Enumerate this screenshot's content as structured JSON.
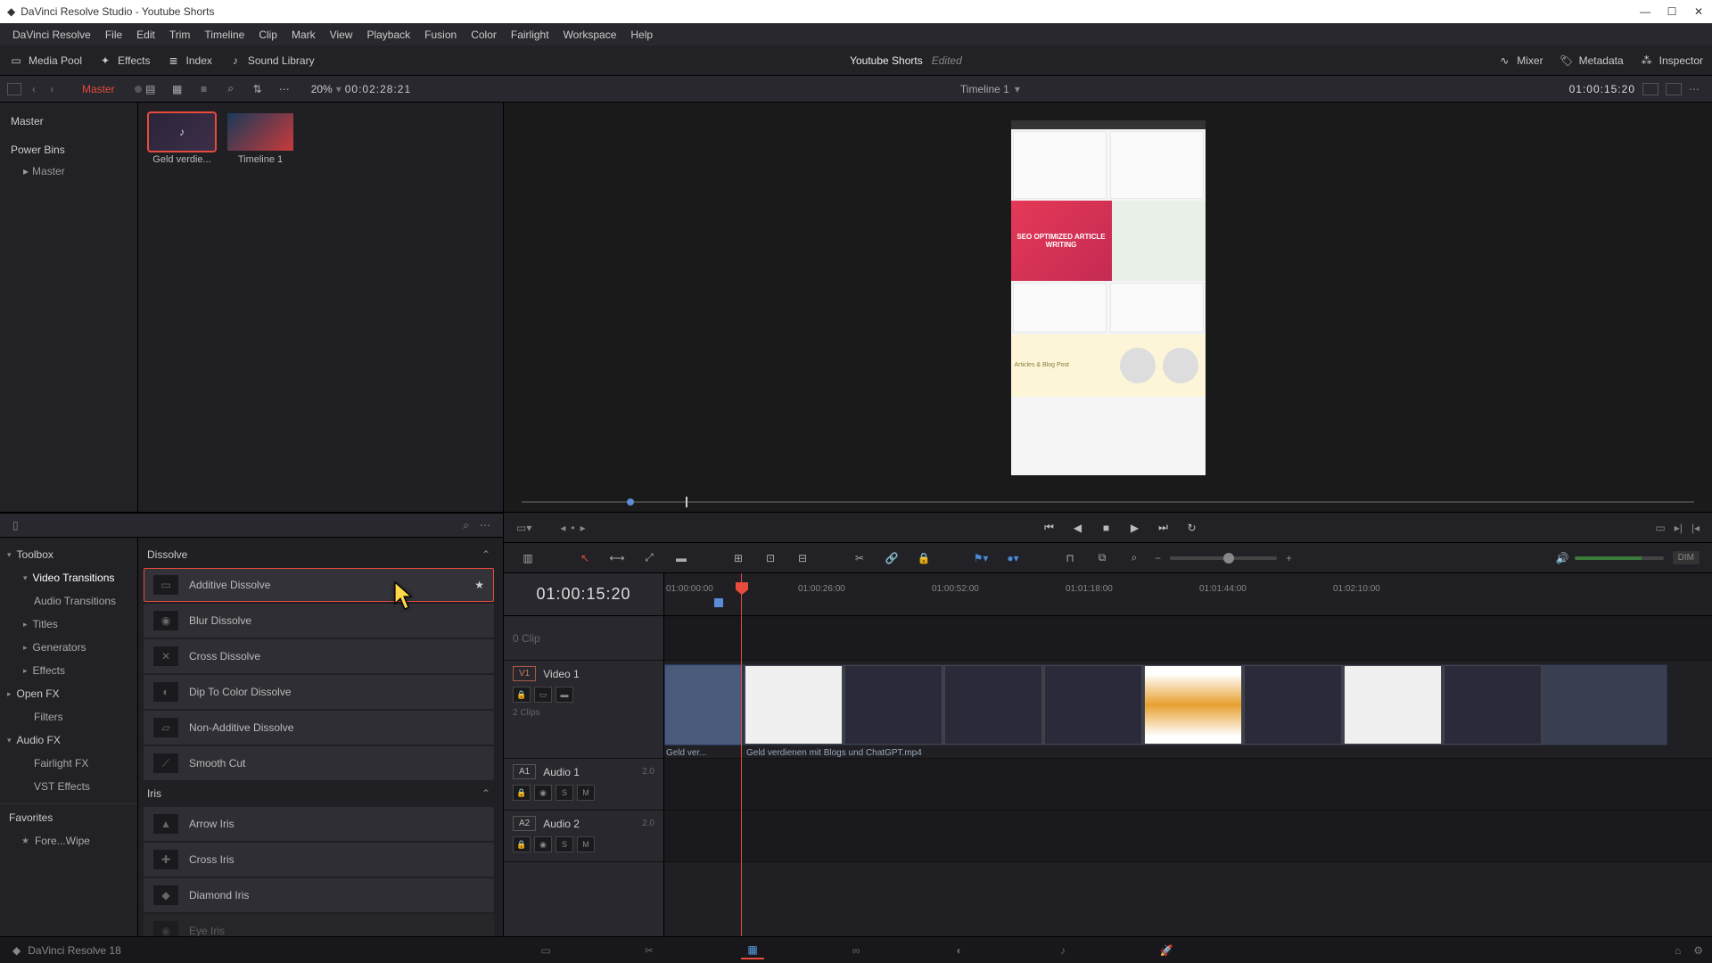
{
  "window": {
    "title": "DaVinci Resolve Studio - Youtube Shorts"
  },
  "menu": [
    "DaVinci Resolve",
    "File",
    "Edit",
    "Trim",
    "Timeline",
    "Clip",
    "Mark",
    "View",
    "Playback",
    "Fusion",
    "Color",
    "Fairlight",
    "Workspace",
    "Help"
  ],
  "toolbar": {
    "mediaPool": "Media Pool",
    "effects": "Effects",
    "index": "Index",
    "soundLib": "Sound Library",
    "project": "Youtube Shorts",
    "status": "Edited",
    "mixer": "Mixer",
    "metadata": "Metadata",
    "inspector": "Inspector"
  },
  "subbar": {
    "master": "Master",
    "zoom": "20%",
    "sourceTC": "00:02:28:21",
    "timelineName": "Timeline 1",
    "recordTC": "01:00:15:20"
  },
  "mediaPool": {
    "tree": {
      "master": "Master",
      "powerBins": "Power Bins",
      "pbMaster": "Master"
    },
    "clips": [
      {
        "label": "Geld verdie...",
        "kind": "audio",
        "selected": true
      },
      {
        "label": "Timeline 1",
        "kind": "timeline",
        "selected": false
      }
    ]
  },
  "fx": {
    "categories": {
      "toolbox": "Toolbox",
      "videoTransitions": "Video Transitions",
      "audioTransitions": "Audio Transitions",
      "titles": "Titles",
      "generators": "Generators",
      "effects": "Effects",
      "openfx": "Open FX",
      "filters": "Filters",
      "audiofx": "Audio FX",
      "fairlightfx": "Fairlight FX",
      "vstfx": "VST Effects",
      "favorites": "Favorites",
      "favItem": "Fore...Wipe"
    },
    "groups": [
      {
        "name": "Dissolve",
        "items": [
          {
            "name": "Additive Dissolve",
            "selected": true
          },
          {
            "name": "Blur Dissolve"
          },
          {
            "name": "Cross Dissolve"
          },
          {
            "name": "Dip To Color Dissolve"
          },
          {
            "name": "Non-Additive Dissolve"
          },
          {
            "name": "Smooth Cut"
          }
        ]
      },
      {
        "name": "Iris",
        "items": [
          {
            "name": "Arrow Iris"
          },
          {
            "name": "Cross Iris"
          },
          {
            "name": "Diamond Iris"
          },
          {
            "name": "Eye Iris"
          }
        ]
      }
    ]
  },
  "viewer": {
    "heroText": "SEO OPTIMIZED ARTICLE WRITING",
    "yelText": "Articles & Blog Post"
  },
  "timeline": {
    "tc": "01:00:15:20",
    "ticks": [
      "01:00:00:00",
      "01:00:26:00",
      "01:00:52:00",
      "01:01:18:00",
      "01:01:44:00",
      "01:02:10:00"
    ],
    "gapTrack": "0 Clip",
    "video1": {
      "tag": "V1",
      "name": "Video 1",
      "clips": "2 Clips",
      "clip1": "Geld ver...",
      "clip2": "Geld verdienen mit Blogs und ChatGPT.mp4"
    },
    "audio1": {
      "tag": "A1",
      "name": "Audio 1",
      "meta": "2.0"
    },
    "audio2": {
      "tag": "A2",
      "name": "Audio 2",
      "meta": "2.0"
    }
  },
  "edittools": {
    "dim": "DIM"
  },
  "footer": {
    "app": "DaVinci Resolve 18"
  }
}
